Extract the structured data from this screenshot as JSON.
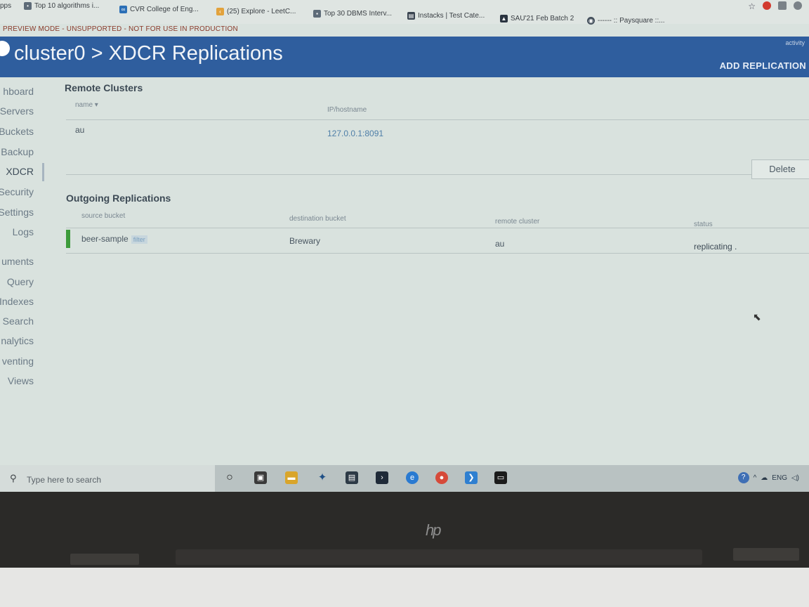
{
  "bookmarks": {
    "items": [
      "pps",
      "Top 10 algorithms i...",
      "CVR College of Eng...",
      "(25) Explore - LeetC...",
      "Top 30 DBMS Interv...",
      "Instacks | Test Cate...",
      "SAU'21 Feb Batch 2",
      "------ :: Paysquare ::..."
    ]
  },
  "preview_banner": "PREVIEW MODE - UNSUPPORTED - NOT FOR USE IN PRODUCTION",
  "header": {
    "title": "cluster0 > XDCR Replications",
    "activity": "activity",
    "add_replication": "ADD REPLICATION"
  },
  "sidebar": {
    "items": [
      {
        "label": "hboard"
      },
      {
        "label": "Servers"
      },
      {
        "label": "Buckets"
      },
      {
        "label": "Backup"
      },
      {
        "label": "XDCR"
      },
      {
        "label": "Security"
      },
      {
        "label": "Settings"
      },
      {
        "label": "Logs"
      },
      {
        "label": "uments"
      },
      {
        "label": "Query"
      },
      {
        "label": "Indexes"
      },
      {
        "label": "Search"
      },
      {
        "label": "nalytics"
      },
      {
        "label": "venting"
      },
      {
        "label": "Views"
      }
    ],
    "active": "XDCR"
  },
  "remote_clusters": {
    "title": "Remote Clusters",
    "columns": [
      "name ▾",
      "IP/hostname"
    ],
    "rows": [
      {
        "name": "au",
        "host": "127.0.0.1:8091"
      }
    ],
    "delete_label": "Delete"
  },
  "outgoing_replications": {
    "title": "Outgoing Replications",
    "columns": [
      "source bucket",
      "destination bucket",
      "remote cluster",
      "status"
    ],
    "rows": [
      {
        "source": "beer-sample",
        "filter_tag": "filter",
        "destination": "Brewary",
        "remote": "au",
        "status": "replicating ."
      }
    ]
  },
  "taskbar": {
    "search_placeholder": "Type here to search",
    "tray_text": "ENG"
  },
  "bezel": {
    "logo": "hp"
  },
  "colors": {
    "header_blue": "#2f5e9e",
    "status_green": "#3c9b3a",
    "link_blue": "#4f7fa8"
  }
}
